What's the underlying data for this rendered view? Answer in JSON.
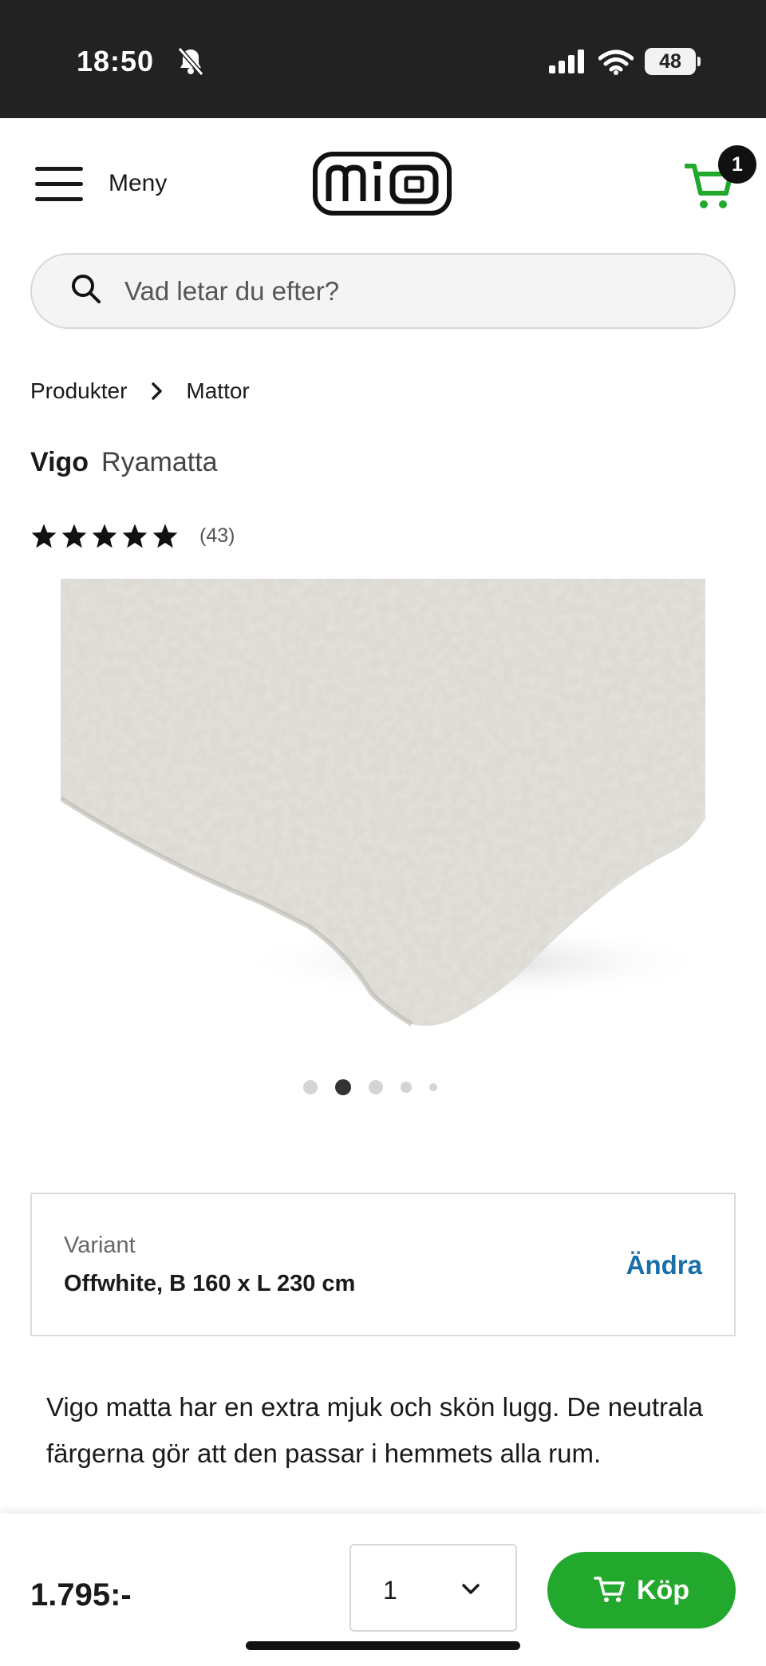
{
  "status_bar": {
    "time": "18:50",
    "battery": "48",
    "icons": [
      "bell-slash-icon",
      "signal-icon",
      "wifi-icon",
      "battery-icon"
    ]
  },
  "header": {
    "menu_label": "Meny",
    "logo_text": "MIO",
    "cart_count": "1",
    "cart_color": "#22a82c"
  },
  "search": {
    "placeholder": "Vad letar du efter?"
  },
  "breadcrumb": {
    "items": [
      "Produkter",
      "Mattor"
    ]
  },
  "product": {
    "brand": "Vigo",
    "type": "Ryamatta",
    "rating": 5,
    "rating_count": "(43)",
    "image_count": 5,
    "active_image": 2
  },
  "variant": {
    "label": "Variant",
    "value": "Offwhite, B 160 x L 230 cm",
    "change_label": "Ändra"
  },
  "description": "Vigo matta har en extra mjuk och skön lugg. De neutrala färgerna gör att den passar i hemmets alla rum.",
  "purchase": {
    "price": "1.795:-",
    "quantity": "1",
    "buy_label": "Köp",
    "buy_color": "#22a82c"
  }
}
